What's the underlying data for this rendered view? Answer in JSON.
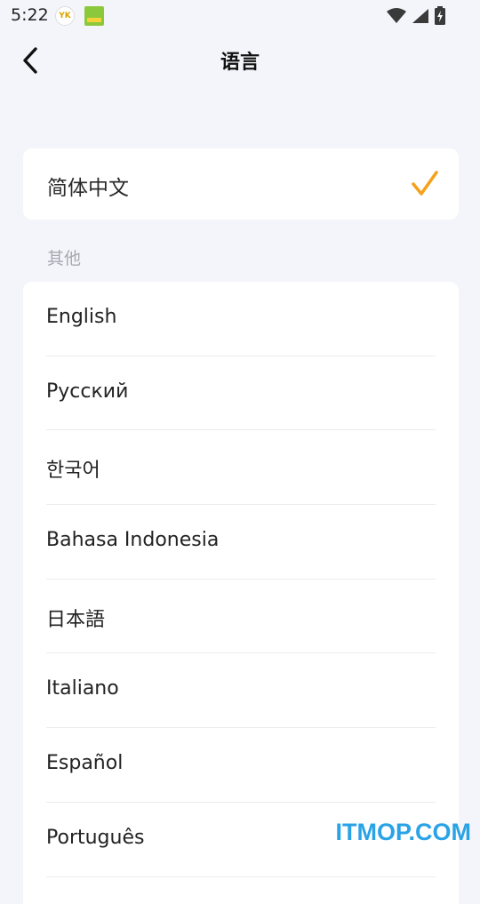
{
  "status_bar": {
    "time": "5:22",
    "notif_icon_1_text": "YK"
  },
  "header": {
    "title": "语言",
    "back_icon": "chevron-left-icon"
  },
  "current_language": {
    "label": "简体中文",
    "check_icon": "checkmark-icon",
    "accent_color": "#f5a21b"
  },
  "section": {
    "other_label": "其他"
  },
  "languages": [
    {
      "label": "English"
    },
    {
      "label": "Русский"
    },
    {
      "label": "한국어"
    },
    {
      "label": "Bahasa Indonesia"
    },
    {
      "label": "日本語"
    },
    {
      "label": "Italiano"
    },
    {
      "label": "Español"
    },
    {
      "label": "Português"
    }
  ],
  "watermark": {
    "text": "ITMOP.COM",
    "color": "#2aa3e6"
  }
}
